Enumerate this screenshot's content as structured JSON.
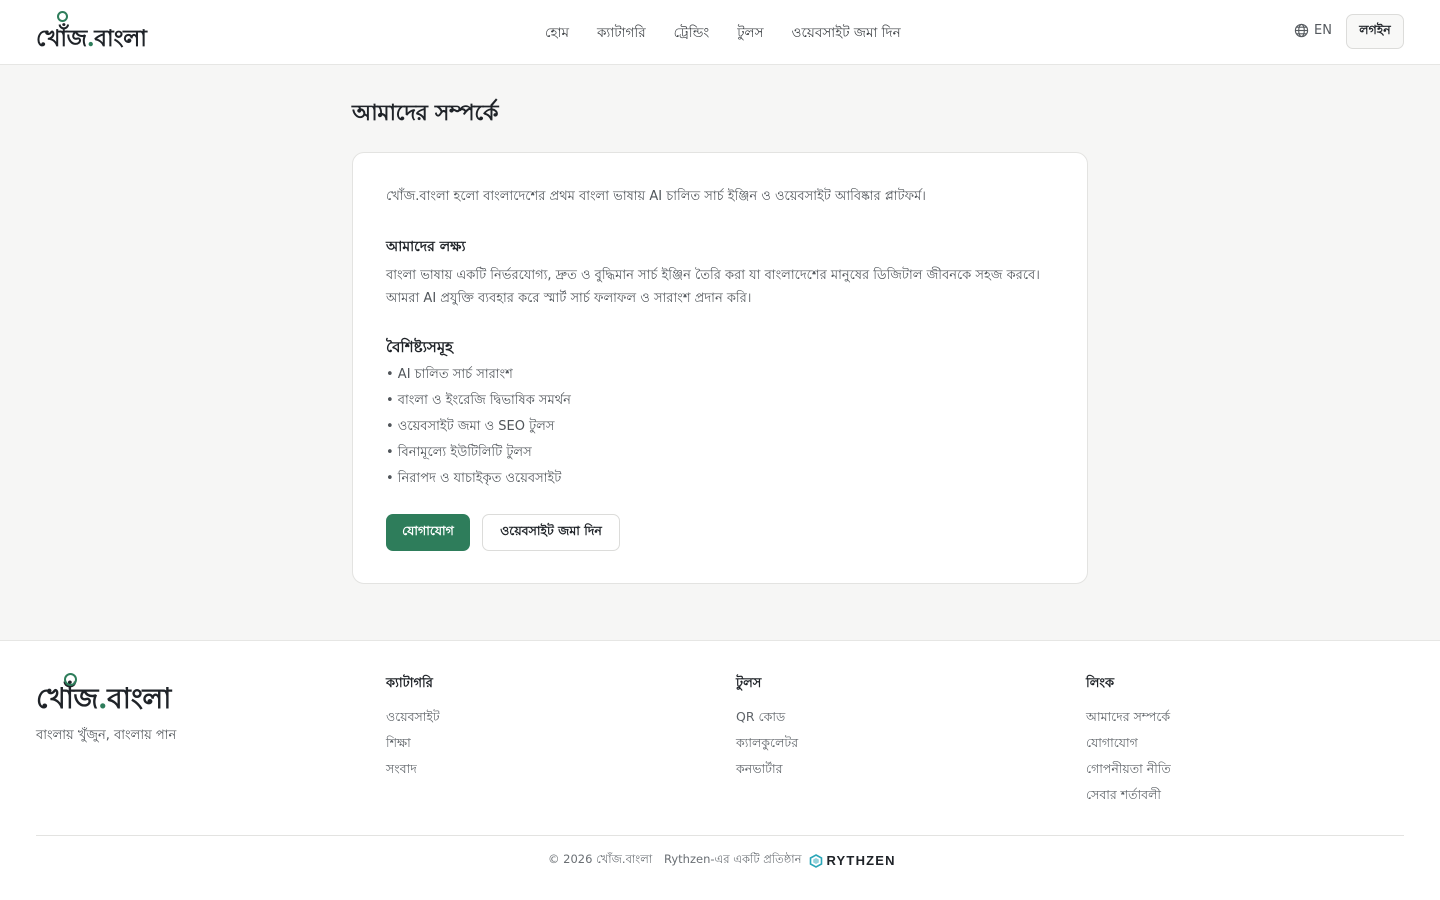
{
  "header": {
    "logo_main": "খোঁজ",
    "logo_dot": ".",
    "logo_tail": "বাংলা",
    "nav": [
      "হোম",
      "ক্যাটাগরি",
      "ট্রেন্ডিং",
      "টুলস",
      "ওয়েবসাইট জমা দিন"
    ],
    "lang": "EN",
    "login": "লগইন"
  },
  "main": {
    "title": "আমাদের সম্পর্কে",
    "intro": "খোঁজ.বাংলা হলো বাংলাদেশের প্রথম বাংলা ভাষায় AI চালিত সার্চ ইঞ্জিন ও ওয়েবসাইট আবিষ্কার প্লাটফর্ম।",
    "mission_heading": "আমাদের লক্ষ্য",
    "mission_line1": "বাংলা ভাষায় একটি নির্ভরযোগ্য, দ্রুত ও বুদ্ধিমান সার্চ ইঞ্জিন তৈরি করা যা বাংলাদেশের মানুষের ডিজিটাল জীবনকে সহজ করবে।",
    "mission_line2": "আমরা AI প্রযুক্তি ব্যবহার করে স্মার্ট সার্চ ফলাফল ও সারাংশ প্রদান করি।",
    "features_heading": "বৈশিষ্ট্যসমূহ",
    "features": [
      "• AI চালিত সার্চ সারাংশ",
      "• বাংলা ও ইংরেজি দ্বিভাষিক সমর্থন",
      "• ওয়েবসাইট জমা ও SEO টুলস",
      "• বিনামূল্যে ইউটিলিটি টুলস",
      "• নিরাপদ ও যাচাইকৃত ওয়েবসাইট"
    ],
    "contact_button": "যোগাযোগ",
    "submit_button": "ওয়েবসাইট জমা দিন"
  },
  "footer": {
    "tagline": "বাংলায় খুঁজুন, বাংলায় পান",
    "categories": {
      "heading": "ক্যাটাগরি",
      "items": [
        "ওয়েবসাইট",
        "শিক্ষা",
        "সংবাদ"
      ]
    },
    "tools": {
      "heading": "টুলস",
      "items": [
        "QR কোড",
        "ক্যালকুলেটর",
        "কনভার্টার"
      ]
    },
    "links": {
      "heading": "লিংক",
      "items": [
        "আমাদের সম্পর্কে",
        "যোগাযোগ",
        "গোপনীয়তা নীতি",
        "সেবার শর্তাবলী"
      ]
    },
    "copyright": "© 2026 খোঁজ.বাংলা",
    "powered_by": "Rythzen-এর একটি প্রতিষ্ঠান",
    "brand": "RYTHZEN"
  },
  "colors": {
    "accent": "#2e7d5b",
    "background": "#f6f6f5",
    "card": "#ffffff",
    "text": "#1f2328"
  },
  "icons": {
    "lang": "globe-icon",
    "logo_mark": "magnifier-icon",
    "brand_mark": "rythzen-logo-icon"
  }
}
